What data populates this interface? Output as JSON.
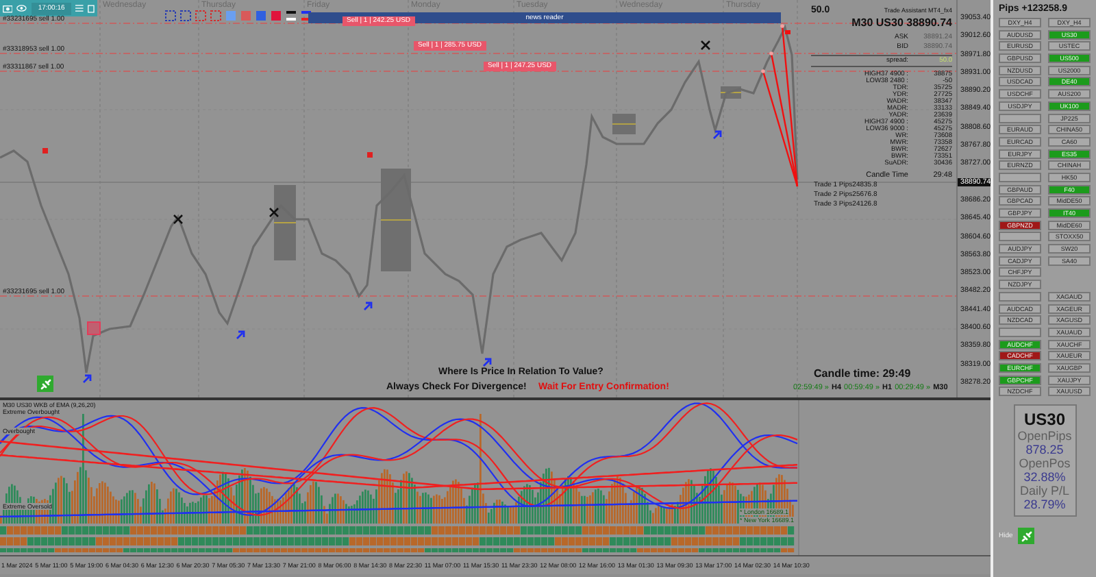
{
  "toolbar": {
    "time": "17:00:16"
  },
  "day_labels": [
    "Wednesday",
    "Thursday",
    "Friday",
    "Monday",
    "Tuesday",
    "Wednesday",
    "Thursday"
  ],
  "order_lines": [
    {
      "label": "#33231695 sell 1.00"
    },
    {
      "label": "#33318953 sell 1.00"
    },
    {
      "label": "#33311867 sell 1.00"
    },
    {
      "label": "#33231695 sell 1.00"
    }
  ],
  "sell_tags": [
    "Sell | 1 | 242.25 USD",
    "Sell | 1 | 285.75 USD",
    "Sell | 1 | 247.25 USD"
  ],
  "news_reader": {
    "title": "news reader"
  },
  "info_panel": {
    "spread_value": "50.0",
    "title": "Trade Assistant MT4_fx4",
    "symbol": "M30 US30 38890.74",
    "quotes": [
      {
        "label": "ASK",
        "value": "38891.24"
      },
      {
        "label": "BID",
        "value": "38890.74"
      }
    ],
    "spread": {
      "label": "spread:",
      "value": "50.0"
    },
    "stats": [
      {
        "label": "HIGH37 4900 :",
        "value": "38875"
      },
      {
        "label": "LOW38 2480 :",
        "value": "-50"
      },
      {
        "label": "TDR:",
        "value": "35725"
      },
      {
        "label": "YDR:",
        "value": "27725"
      },
      {
        "label": "WADR:",
        "value": "38347"
      },
      {
        "label": "MADR:",
        "value": "33133"
      },
      {
        "label": "YADR:",
        "value": "23639"
      },
      {
        "label": "HIGH37 4900 :",
        "value": "45275"
      },
      {
        "label": "LOW36 9000 :",
        "value": "45275"
      },
      {
        "label": "WR:",
        "value": "73608"
      },
      {
        "label": "MWR:",
        "value": "73358"
      },
      {
        "label": "BWR:",
        "value": "72627"
      },
      {
        "label": "BWR:",
        "value": "73351"
      },
      {
        "label": "SuADR:",
        "value": "30436"
      }
    ],
    "candle": {
      "label": "Candle Time",
      "value": "29:48"
    },
    "trades": [
      "Trade 1 Pips24835.8",
      "Trade 2 Pips25676.8",
      "Trade 3 Pips24126.8"
    ]
  },
  "price_axis": {
    "labels": [
      {
        "text": "39053.40",
        "current": false
      },
      {
        "text": "39012.60",
        "current": false
      },
      {
        "text": "38971.80",
        "current": false
      },
      {
        "text": "38931.00",
        "current": false
      },
      {
        "text": "38890.20",
        "current": false
      },
      {
        "text": "38849.40",
        "current": false
      },
      {
        "text": "38808.60",
        "current": false
      },
      {
        "text": "38767.80",
        "current": false
      },
      {
        "text": "38727.00",
        "current": false
      },
      {
        "text": "38890.74",
        "current": true
      },
      {
        "text": "38686.20",
        "current": false
      },
      {
        "text": "38645.40",
        "current": false
      },
      {
        "text": "38604.60",
        "current": false
      },
      {
        "text": "38563.80",
        "current": false
      },
      {
        "text": "38523.00",
        "current": false
      },
      {
        "text": "38482.20",
        "current": false
      },
      {
        "text": "38441.40",
        "current": false
      },
      {
        "text": "38400.60",
        "current": false
      },
      {
        "text": "38359.80",
        "current": false
      },
      {
        "text": "38319.00",
        "current": false
      },
      {
        "text": "38278.20",
        "current": false
      }
    ]
  },
  "messages": [
    {
      "text": "Where Is Price In Relation To Value?",
      "kind": "question"
    },
    {
      "text": "Always Check For Divergence!",
      "kind": "note"
    },
    {
      "text": "Wait For Entry Confirmation!",
      "kind": "warning"
    }
  ],
  "candle_time": "Candle time:  29:49",
  "timeframes": [
    "02:59:49 »",
    "H4",
    "00:59:49 »",
    "H1",
    "00:29:49 »",
    "M30"
  ],
  "indicator": {
    "title": "M30 US30 WKB of EMA (9,26,20)",
    "levels": [
      "Extreme Overbought",
      "Overbought",
      "Extreme Oversold"
    ],
    "sessions": [
      "* London  16689.1",
      "* New York  16689.1"
    ]
  },
  "time_axis": [
    "1 Mar 2024",
    "5 Mar 11:00",
    "5 Mar 19:00",
    "6 Mar 04:30",
    "6 Mar 12:30",
    "6 Mar 20:30",
    "7 Mar 05:30",
    "7 Mar 13:30",
    "7 Mar 21:00",
    "8 Mar 06:00",
    "8 Mar 14:30",
    "8 Mar 22:30",
    "11 Mar 07:00",
    "11 Mar 15:30",
    "11 Mar 23:30",
    "12 Mar 08:00",
    "12 Mar 16:00",
    "13 Mar 01:30",
    "13 Mar 09:30",
    "13 Mar 17:00",
    "14 Mar 02:30",
    "14 Mar 10:30"
  ],
  "right_panel": {
    "pips": "Pips +123258.9",
    "columns": [
      [
        {
          "kind": "button",
          "label": "DXY_H4",
          "color": "#a9a9a9"
        },
        {
          "kind": "button",
          "label": "AUDUSD",
          "color": "#a9a9a9"
        },
        {
          "kind": "button",
          "label": "EURUSD",
          "color": "#a9a9a9"
        },
        {
          "kind": "button",
          "label": "GBPUSD",
          "color": "#a9a9a9"
        },
        {
          "kind": "button",
          "label": "NZDUSD",
          "color": "#a9a9a9"
        },
        {
          "kind": "button",
          "label": "USDCAD",
          "color": "#a9a9a9"
        },
        {
          "kind": "button",
          "label": "USDCHF",
          "color": "#a9a9a9"
        },
        {
          "kind": "button",
          "label": "USDJPY",
          "color": "#a9a9a9"
        },
        {
          "kind": "blank"
        },
        {
          "kind": "button",
          "label": "EURAUD",
          "color": "#a9a9a9"
        },
        {
          "kind": "button",
          "label": "EURCAD",
          "color": "#a9a9a9"
        },
        {
          "kind": "button",
          "label": "EURJPY",
          "color": "#a9a9a9"
        },
        {
          "kind": "button",
          "label": "EURNZD",
          "color": "#a9a9a9"
        },
        {
          "kind": "blank"
        },
        {
          "kind": "button",
          "label": "GBPAUD",
          "color": "#a9a9a9"
        },
        {
          "kind": "button",
          "label": "GBPCAD",
          "color": "#a9a9a9"
        },
        {
          "kind": "button",
          "label": "GBPJPY",
          "color": "#a9a9a9"
        },
        {
          "kind": "button",
          "label": "GBPNZD",
          "color": "#a01818"
        },
        {
          "kind": "blank"
        },
        {
          "kind": "button",
          "label": "AUDJPY",
          "color": "#a9a9a9"
        },
        {
          "kind": "button",
          "label": "CADJPY",
          "color": "#a9a9a9"
        },
        {
          "kind": "button",
          "label": "CHFJPY",
          "color": "#a9a9a9"
        },
        {
          "kind": "button",
          "label": "NZDJPY",
          "color": "#a9a9a9"
        },
        {
          "kind": "blank"
        },
        {
          "kind": "button",
          "label": "AUDCAD",
          "color": "#a9a9a9"
        },
        {
          "kind": "button",
          "label": "NZDCAD",
          "color": "#a9a9a9"
        },
        {
          "kind": "blank"
        },
        {
          "kind": "button",
          "label": "AUDCHF",
          "color": "#1c9b1c"
        },
        {
          "kind": "button",
          "label": "CADCHF",
          "color": "#a01818"
        },
        {
          "kind": "button",
          "label": "EURCHF",
          "color": "#1c9b1c"
        },
        {
          "kind": "button",
          "label": "GBPCHF",
          "color": "#1c9b1c"
        },
        {
          "kind": "button",
          "label": "NZDCHF",
          "color": "#a9a9a9"
        }
      ],
      [
        {
          "kind": "button",
          "label": "DXY_H4",
          "color": "#a9a9a9"
        },
        {
          "kind": "button",
          "label": "US30",
          "color": "#1c9b1c"
        },
        {
          "kind": "button",
          "label": "USTEC",
          "color": "#a9a9a9"
        },
        {
          "kind": "button",
          "label": "US500",
          "color": "#1c9b1c"
        },
        {
          "kind": "button",
          "label": "US2000",
          "color": "#a9a9a9"
        },
        {
          "kind": "button",
          "label": "DE40",
          "color": "#1c9b1c"
        },
        {
          "kind": "button",
          "label": "AUS200",
          "color": "#a9a9a9"
        },
        {
          "kind": "button",
          "label": "UK100",
          "color": "#1c9b1c"
        },
        {
          "kind": "button",
          "label": "JP225",
          "color": "#a9a9a9"
        },
        {
          "kind": "button",
          "label": "CHINA50",
          "color": "#a9a9a9"
        },
        {
          "kind": "button",
          "label": "CA60",
          "color": "#a9a9a9"
        },
        {
          "kind": "button",
          "label": "ES35",
          "color": "#1c9b1c"
        },
        {
          "kind": "button",
          "label": "CHINAH",
          "color": "#a9a9a9"
        },
        {
          "kind": "button",
          "label": "HK50",
          "color": "#a9a9a9"
        },
        {
          "kind": "button",
          "label": "F40",
          "color": "#1c9b1c"
        },
        {
          "kind": "button",
          "label": "MidDE50",
          "color": "#a9a9a9"
        },
        {
          "kind": "button",
          "label": "IT40",
          "color": "#1c9b1c"
        },
        {
          "kind": "button",
          "label": "MidDE60",
          "color": "#a9a9a9"
        },
        {
          "kind": "button",
          "label": "STOXX50",
          "color": "#a9a9a9"
        },
        {
          "kind": "button",
          "label": "SW20",
          "color": "#a9a9a9"
        },
        {
          "kind": "button",
          "label": "SA40",
          "color": "#a9a9a9"
        },
        {
          "kind": "gap"
        },
        {
          "kind": "gap"
        },
        {
          "kind": "button",
          "label": "XAGAUD",
          "color": "#a9a9a9"
        },
        {
          "kind": "button",
          "label": "XAGEUR",
          "color": "#a9a9a9"
        },
        {
          "kind": "button",
          "label": "XAGUSD",
          "color": "#a9a9a9"
        },
        {
          "kind": "button",
          "label": "XAUAUD",
          "color": "#a9a9a9"
        },
        {
          "kind": "button",
          "label": "XAUCHF",
          "color": "#a9a9a9"
        },
        {
          "kind": "button",
          "label": "XAUEUR",
          "color": "#a9a9a9"
        },
        {
          "kind": "button",
          "label": "XAUGBP",
          "color": "#a9a9a9"
        },
        {
          "kind": "button",
          "label": "XAUJPY",
          "color": "#a9a9a9"
        },
        {
          "kind": "button",
          "label": "XAUUSD",
          "color": "#a9a9a9"
        }
      ]
    ],
    "stats": {
      "symbol": "US30",
      "rows": [
        {
          "label": "OpenPips",
          "value": "878.25"
        },
        {
          "label": "OpenPos",
          "value": "32.88%"
        },
        {
          "label": "Daily P/L",
          "value": "28.79%"
        }
      ]
    },
    "hide": "Hide"
  }
}
